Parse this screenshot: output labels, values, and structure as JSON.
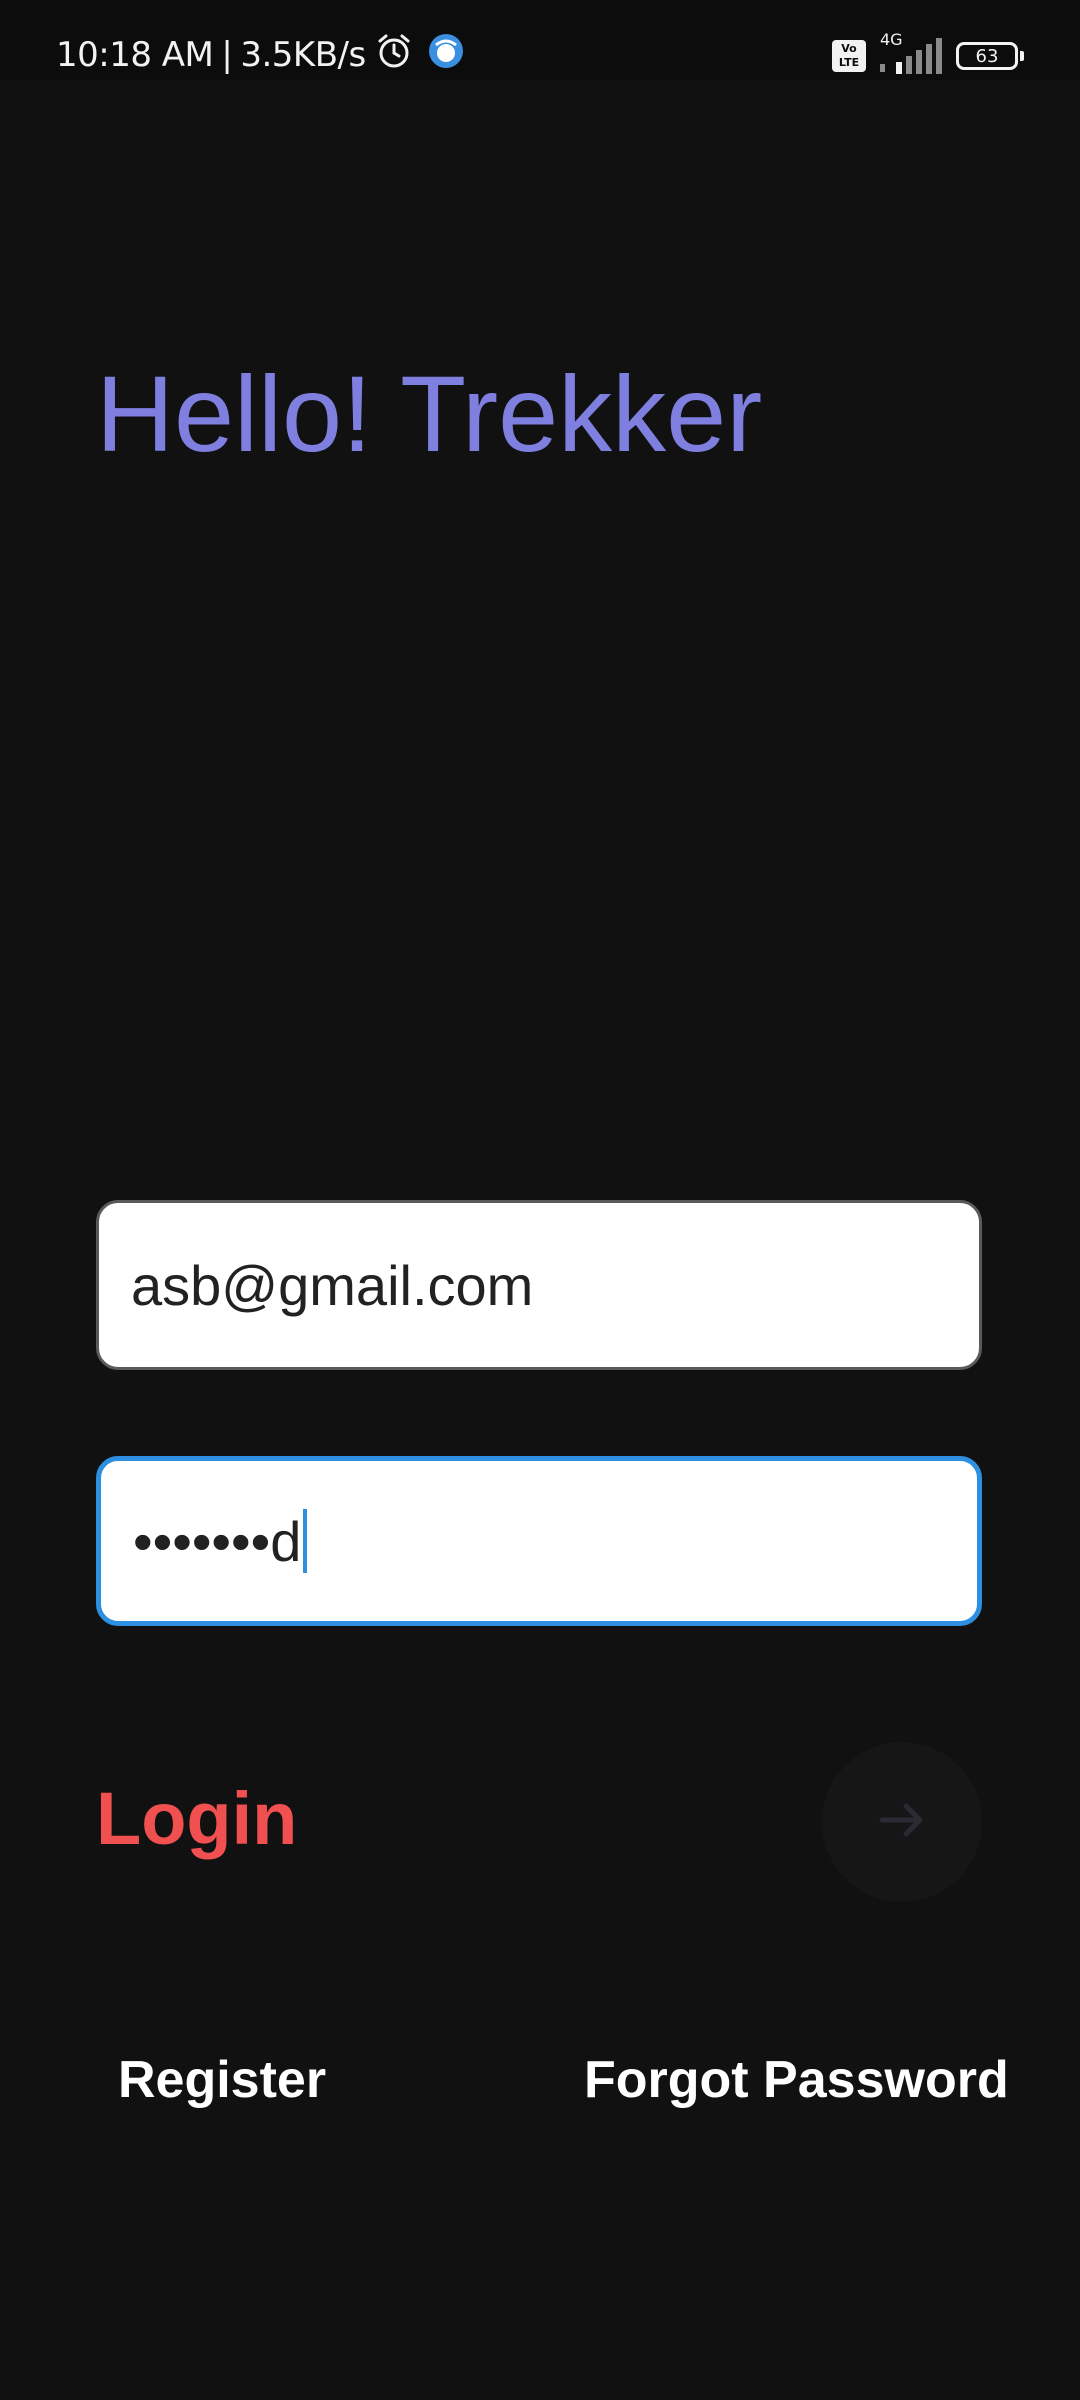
{
  "status_bar": {
    "time": "10:18 AM",
    "separator": "|",
    "network_speed": "3.5KB/s",
    "volte_line1": "Vo",
    "volte_line2": "LTE",
    "network_type": "4G",
    "battery_level": "63",
    "icons": [
      "alarm-icon",
      "browser-app-icon",
      "volte-icon",
      "signal-icon",
      "battery-icon"
    ]
  },
  "header": {
    "title": "Hello! Trekker"
  },
  "form": {
    "email_value": "asb@gmail.com",
    "password_value": "•••••••d"
  },
  "login": {
    "label": "Login",
    "arrow_icon": "arrow-right-icon"
  },
  "links": {
    "register": "Register",
    "forgot_password": "Forgot Password"
  },
  "colors": {
    "background": "#111112",
    "title": "#7f7fe0",
    "login": "#f05050",
    "focus_border": "#2d8fe0"
  }
}
